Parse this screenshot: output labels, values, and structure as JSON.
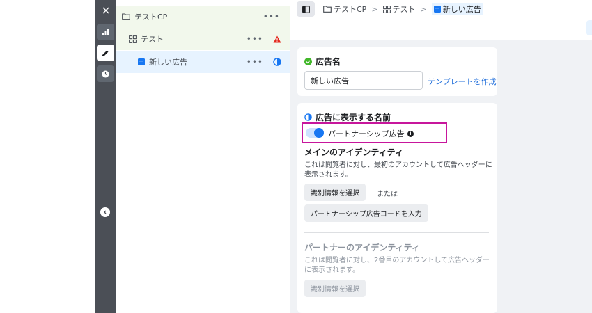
{
  "rail": {
    "close_icon": "close-icon",
    "chart_icon": "bar-chart-icon",
    "edit_icon": "pencil-icon",
    "history_icon": "clock-icon",
    "collapse_icon": "chevron-left-icon"
  },
  "tree": {
    "campaign": {
      "label": "テストCP",
      "more": "•••",
      "icon": "folder-icon"
    },
    "adset": {
      "label": "テスト",
      "more": "•••",
      "icon": "grid-icon",
      "status_icon": "warning-icon"
    },
    "ad": {
      "label": "新しい広告",
      "more": "•••",
      "icon": "ad-square-icon",
      "status_icon": "half-circle-icon"
    }
  },
  "breadcrumb": {
    "items": [
      "テストCP",
      "テスト",
      "新しい広告"
    ],
    "separator": ">"
  },
  "ad_name": {
    "title": "広告名",
    "value": "新しい広告",
    "template_link": "テンプレートを作成"
  },
  "display_name": {
    "title": "広告に表示する名前",
    "partnership_label": "パートナーシップ広告",
    "partnership_enabled": true,
    "info": "i",
    "main_identity": {
      "heading": "メインのアイデンティティ",
      "description": "これは閲覧者に対し、最初のアカウントして広告ヘッダーに表示されます。",
      "select_button": "識別情報を選択",
      "or_text": "または",
      "code_button": "パートナーシップ広告コードを入力"
    },
    "partner_identity": {
      "heading": "パートナーのアイデンティティ",
      "description": "これは閲覧者に対し、2番目のアカウントして広告ヘッダーに表示されます。",
      "select_button": "識別情報を選択"
    }
  },
  "colors": {
    "accent": "#1877f2",
    "highlight_border": "#c7169c",
    "success": "#42b72a",
    "warning": "#e4271b"
  }
}
